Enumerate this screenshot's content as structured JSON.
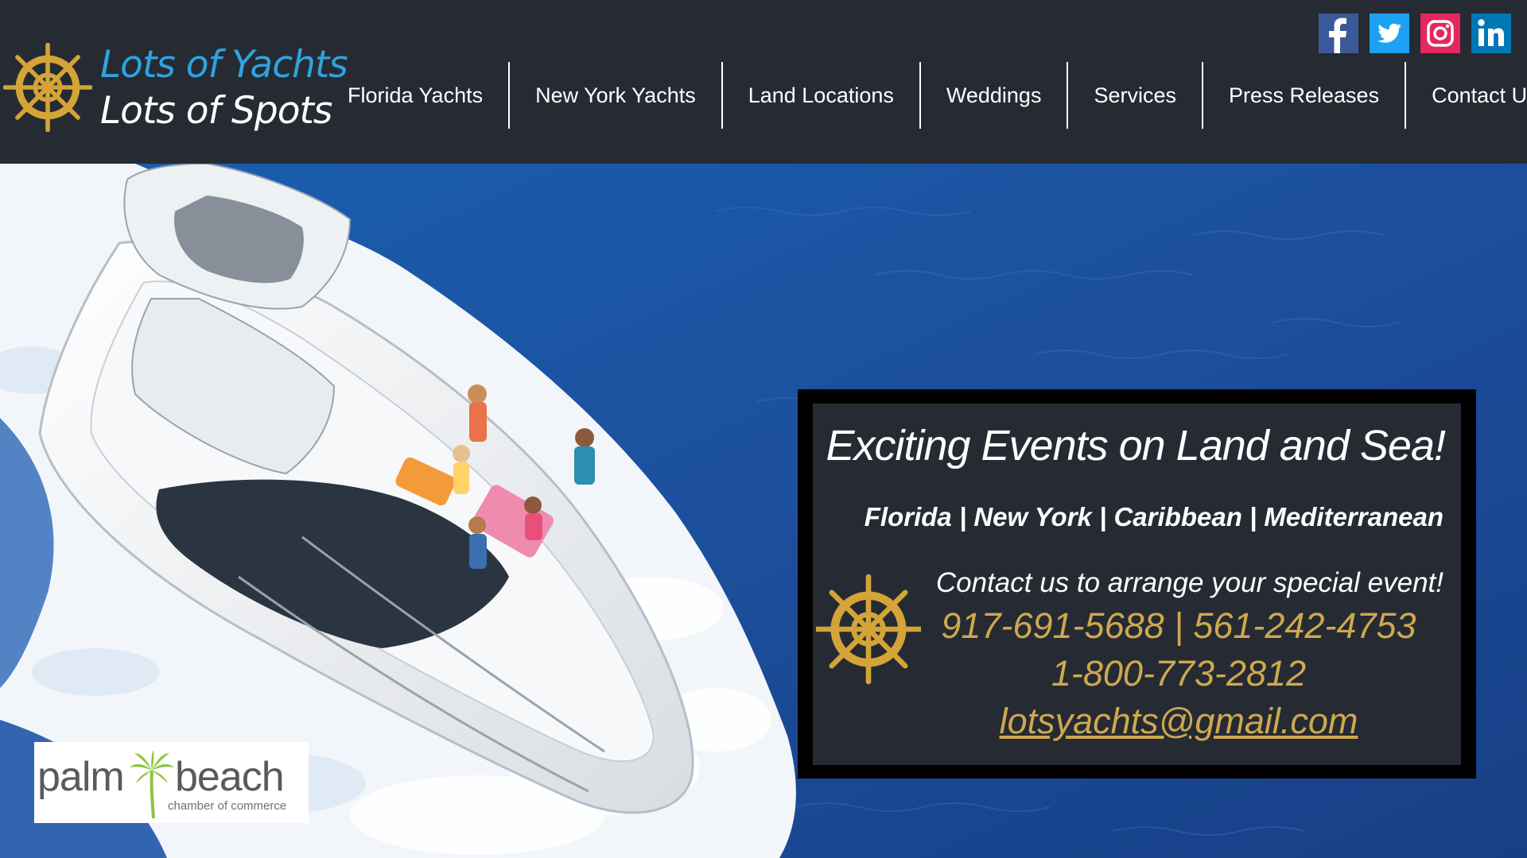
{
  "brand": {
    "line1": "Lots of Yachts",
    "line2": "Lots of Spots",
    "accent_color": "#2ea3e0",
    "gold_color": "#cfa84e"
  },
  "nav": {
    "items": [
      {
        "label": "Florida Yachts"
      },
      {
        "label": "New York Yachts"
      },
      {
        "label": "Land Locations"
      },
      {
        "label": "Weddings"
      },
      {
        "label": "Services"
      },
      {
        "label": "Press Releases"
      },
      {
        "label": "Contact Us"
      }
    ]
  },
  "social": [
    {
      "name": "facebook-icon",
      "color": "#3b5998"
    },
    {
      "name": "twitter-icon",
      "color": "#1da1f2"
    },
    {
      "name": "instagram-icon",
      "color": "#e4285d"
    },
    {
      "name": "linkedin-icon",
      "color": "#0077b5"
    }
  ],
  "event_card": {
    "title": "Exciting Events on Land and Sea!",
    "regions": "Florida | New York | Caribbean | Mediterranean",
    "cta": "Contact us to arrange your special event!",
    "phones": "917-691-5688 | 561-242-4753",
    "tollfree": "1-800-773-2812",
    "email": "lotsyachts@gmail.com"
  },
  "chamber": {
    "word1": "palm",
    "word2": "beach",
    "subtitle": "chamber of commerce"
  }
}
